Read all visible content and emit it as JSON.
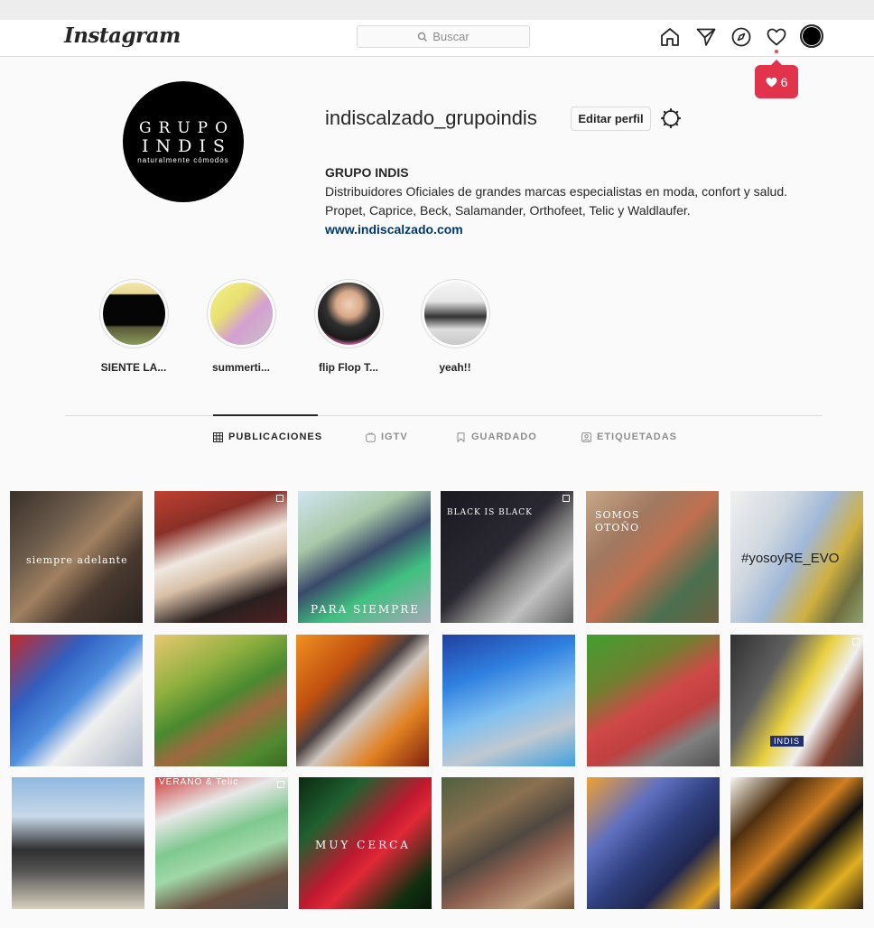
{
  "header": {
    "logo_text": "Instagram",
    "search_placeholder": "Buscar",
    "notification_count": "6"
  },
  "profile": {
    "username": "indiscalzado_grupoindis",
    "edit_label": "Editar perfil",
    "pic_line1": "GRUPO",
    "pic_line2": "INDIS",
    "pic_line3": "naturalmente cómodos",
    "name": "GRUPO INDIS",
    "bio_line1": "Distribuidores Oficiales de grandes marcas especialistas en moda, confort y salud.",
    "bio_line2": "Propet, Caprice, Beck, Salamander, Orthofeet, Telic y Waldlaufer.",
    "website": "www.indiscalzado.com"
  },
  "highlights": [
    {
      "label": "SIENTE LA..."
    },
    {
      "label": "summerti..."
    },
    {
      "label": "flip Flop T..."
    },
    {
      "label": "yeah!!"
    }
  ],
  "tabs": [
    {
      "label": "PUBLICACIONES",
      "active": true
    },
    {
      "label": "IGTV"
    },
    {
      "label": "GUARDADO"
    },
    {
      "label": "ETIQUETADAS"
    }
  ],
  "posts": [
    {
      "overlay": "siempre adelante"
    },
    {
      "overlay": ""
    },
    {
      "overlay": "PARA SIEMPRE"
    },
    {
      "overlay": "BLACK IS BLACK"
    },
    {
      "overlay": "SOMOS OTOÑO"
    },
    {
      "overlay": "#yosoyRE_EVO"
    },
    {
      "overlay": ""
    },
    {
      "overlay": ""
    },
    {
      "overlay": ""
    },
    {
      "overlay": ""
    },
    {
      "overlay": ""
    },
    {
      "overlay": "INDIS"
    },
    {
      "overlay": ""
    },
    {
      "overlay": "VERANO & Telic"
    },
    {
      "overlay": "MUY CERCA"
    },
    {
      "overlay": ""
    },
    {
      "overlay": ""
    },
    {
      "overlay": ""
    }
  ],
  "colors": {
    "link": "#00376b",
    "notification": "#e1334b",
    "border": "#dbdbdb"
  }
}
